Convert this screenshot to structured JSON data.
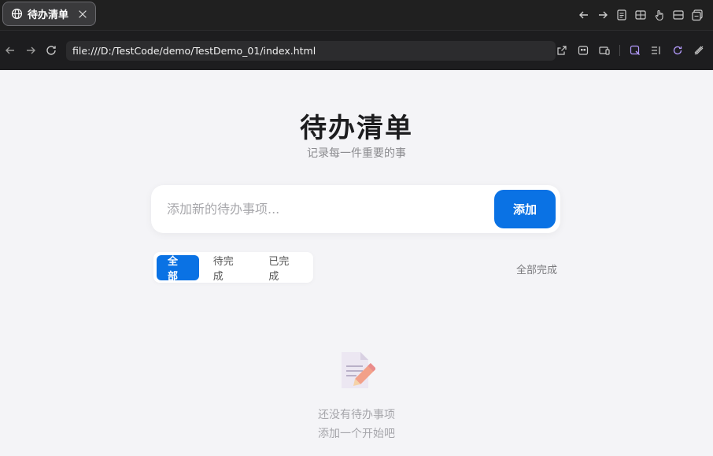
{
  "browser": {
    "tab_title": "待办清单",
    "url": "file:///D:/TestCode/demo/TestDemo_01/index.html"
  },
  "app": {
    "title": "待办清单",
    "subtitle": "记录每一件重要的事",
    "input_placeholder": "添加新的待办事项...",
    "add_label": "添加",
    "filters": [
      {
        "label": "全部",
        "active": true
      },
      {
        "label": "待完成",
        "active": false
      },
      {
        "label": "已完成",
        "active": false
      }
    ],
    "complete_all_label": "全部完成",
    "empty_state": {
      "icon": "memo-icon",
      "line1": "还没有待办事项",
      "line2": "添加一个开始吧"
    }
  },
  "colors": {
    "accent": "#0a72e4",
    "page_bg": "#f4f4f7",
    "chrome_bg": "#1d1d1f"
  }
}
